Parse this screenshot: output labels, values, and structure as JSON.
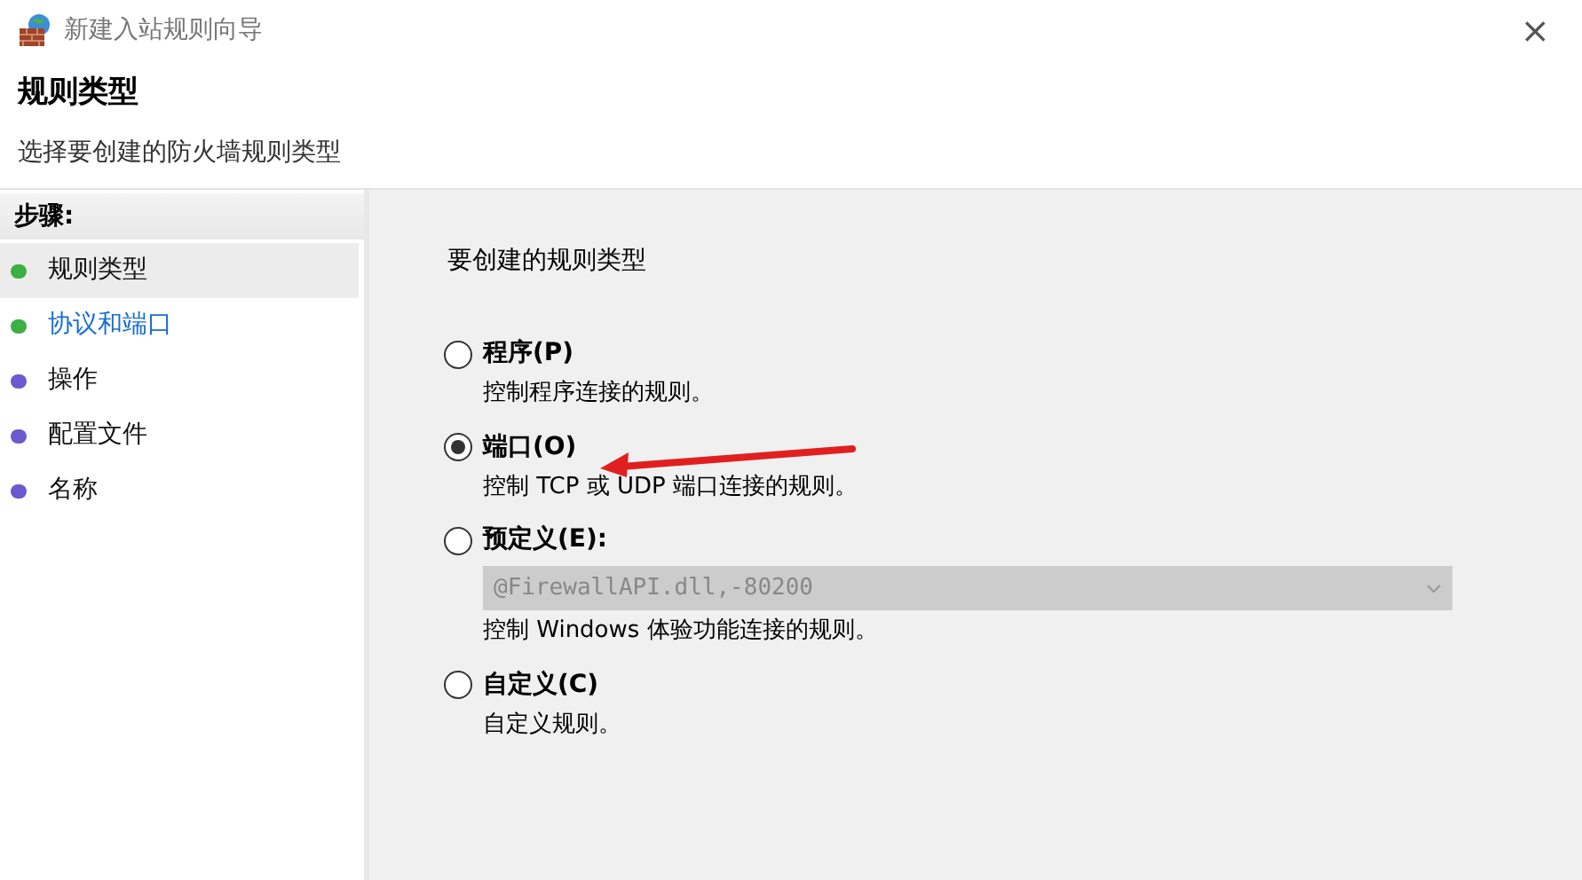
{
  "window": {
    "title": "新建入站规则向导",
    "close": "×"
  },
  "header": {
    "title": "规则类型",
    "subtitle": "选择要创建的防火墙规则类型"
  },
  "steps": {
    "heading": "步骤:",
    "items": [
      {
        "label": "规则类型",
        "selected": true,
        "link": false,
        "color": "#3cb043"
      },
      {
        "label": "协议和端口",
        "selected": false,
        "link": true,
        "color": "#3cb043"
      },
      {
        "label": "操作",
        "selected": false,
        "link": false,
        "color": "#6a5acd"
      },
      {
        "label": "配置文件",
        "selected": false,
        "link": false,
        "color": "#6a5acd"
      },
      {
        "label": "名称",
        "selected": false,
        "link": false,
        "color": "#6a5acd"
      }
    ]
  },
  "content": {
    "prompt": "要创建的规则类型",
    "options": [
      {
        "label": "程序(P)",
        "description": "控制程序连接的规则。",
        "selected": false
      },
      {
        "label": "端口(O)",
        "description": "控制 TCP 或 UDP 端口连接的规则。",
        "selected": true
      },
      {
        "label": "预定义(E):",
        "description": "控制 Windows 体验功能连接的规则。",
        "selected": false,
        "dropdown": {
          "value": "@FirewallAPI.dll,-80200",
          "disabled": true
        }
      },
      {
        "label": "自定义(C)",
        "description": "自定义规则。",
        "selected": false
      }
    ]
  }
}
